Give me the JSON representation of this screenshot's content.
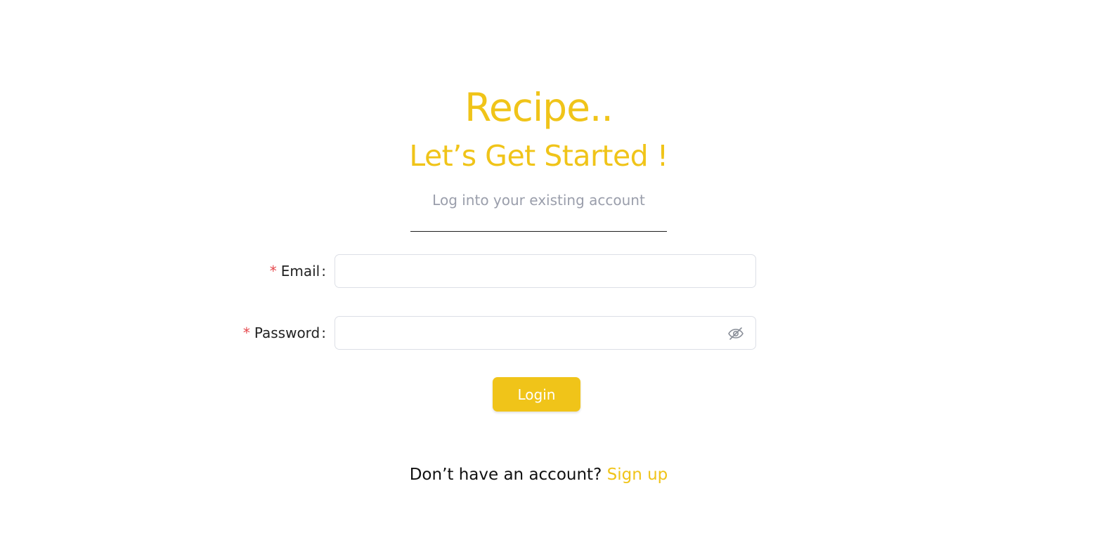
{
  "brand": {
    "name": "Recipe.."
  },
  "header": {
    "title": "Let’s Get Started !",
    "subtitle": "Log into your existing account"
  },
  "form": {
    "email": {
      "label": "Email",
      "required_mark": "*",
      "colon": ":",
      "value": ""
    },
    "password": {
      "label": "Password",
      "required_mark": "*",
      "colon": ":",
      "value": "",
      "toggle_icon": "eye-off-icon"
    },
    "submit_label": "Login"
  },
  "footer": {
    "prompt": "Don’t have an account?",
    "link_label": "Sign up"
  },
  "colors": {
    "accent": "#f0c419",
    "muted_text": "#9a9eab",
    "required": "#e5484d",
    "input_border": "#dcdfe6"
  }
}
